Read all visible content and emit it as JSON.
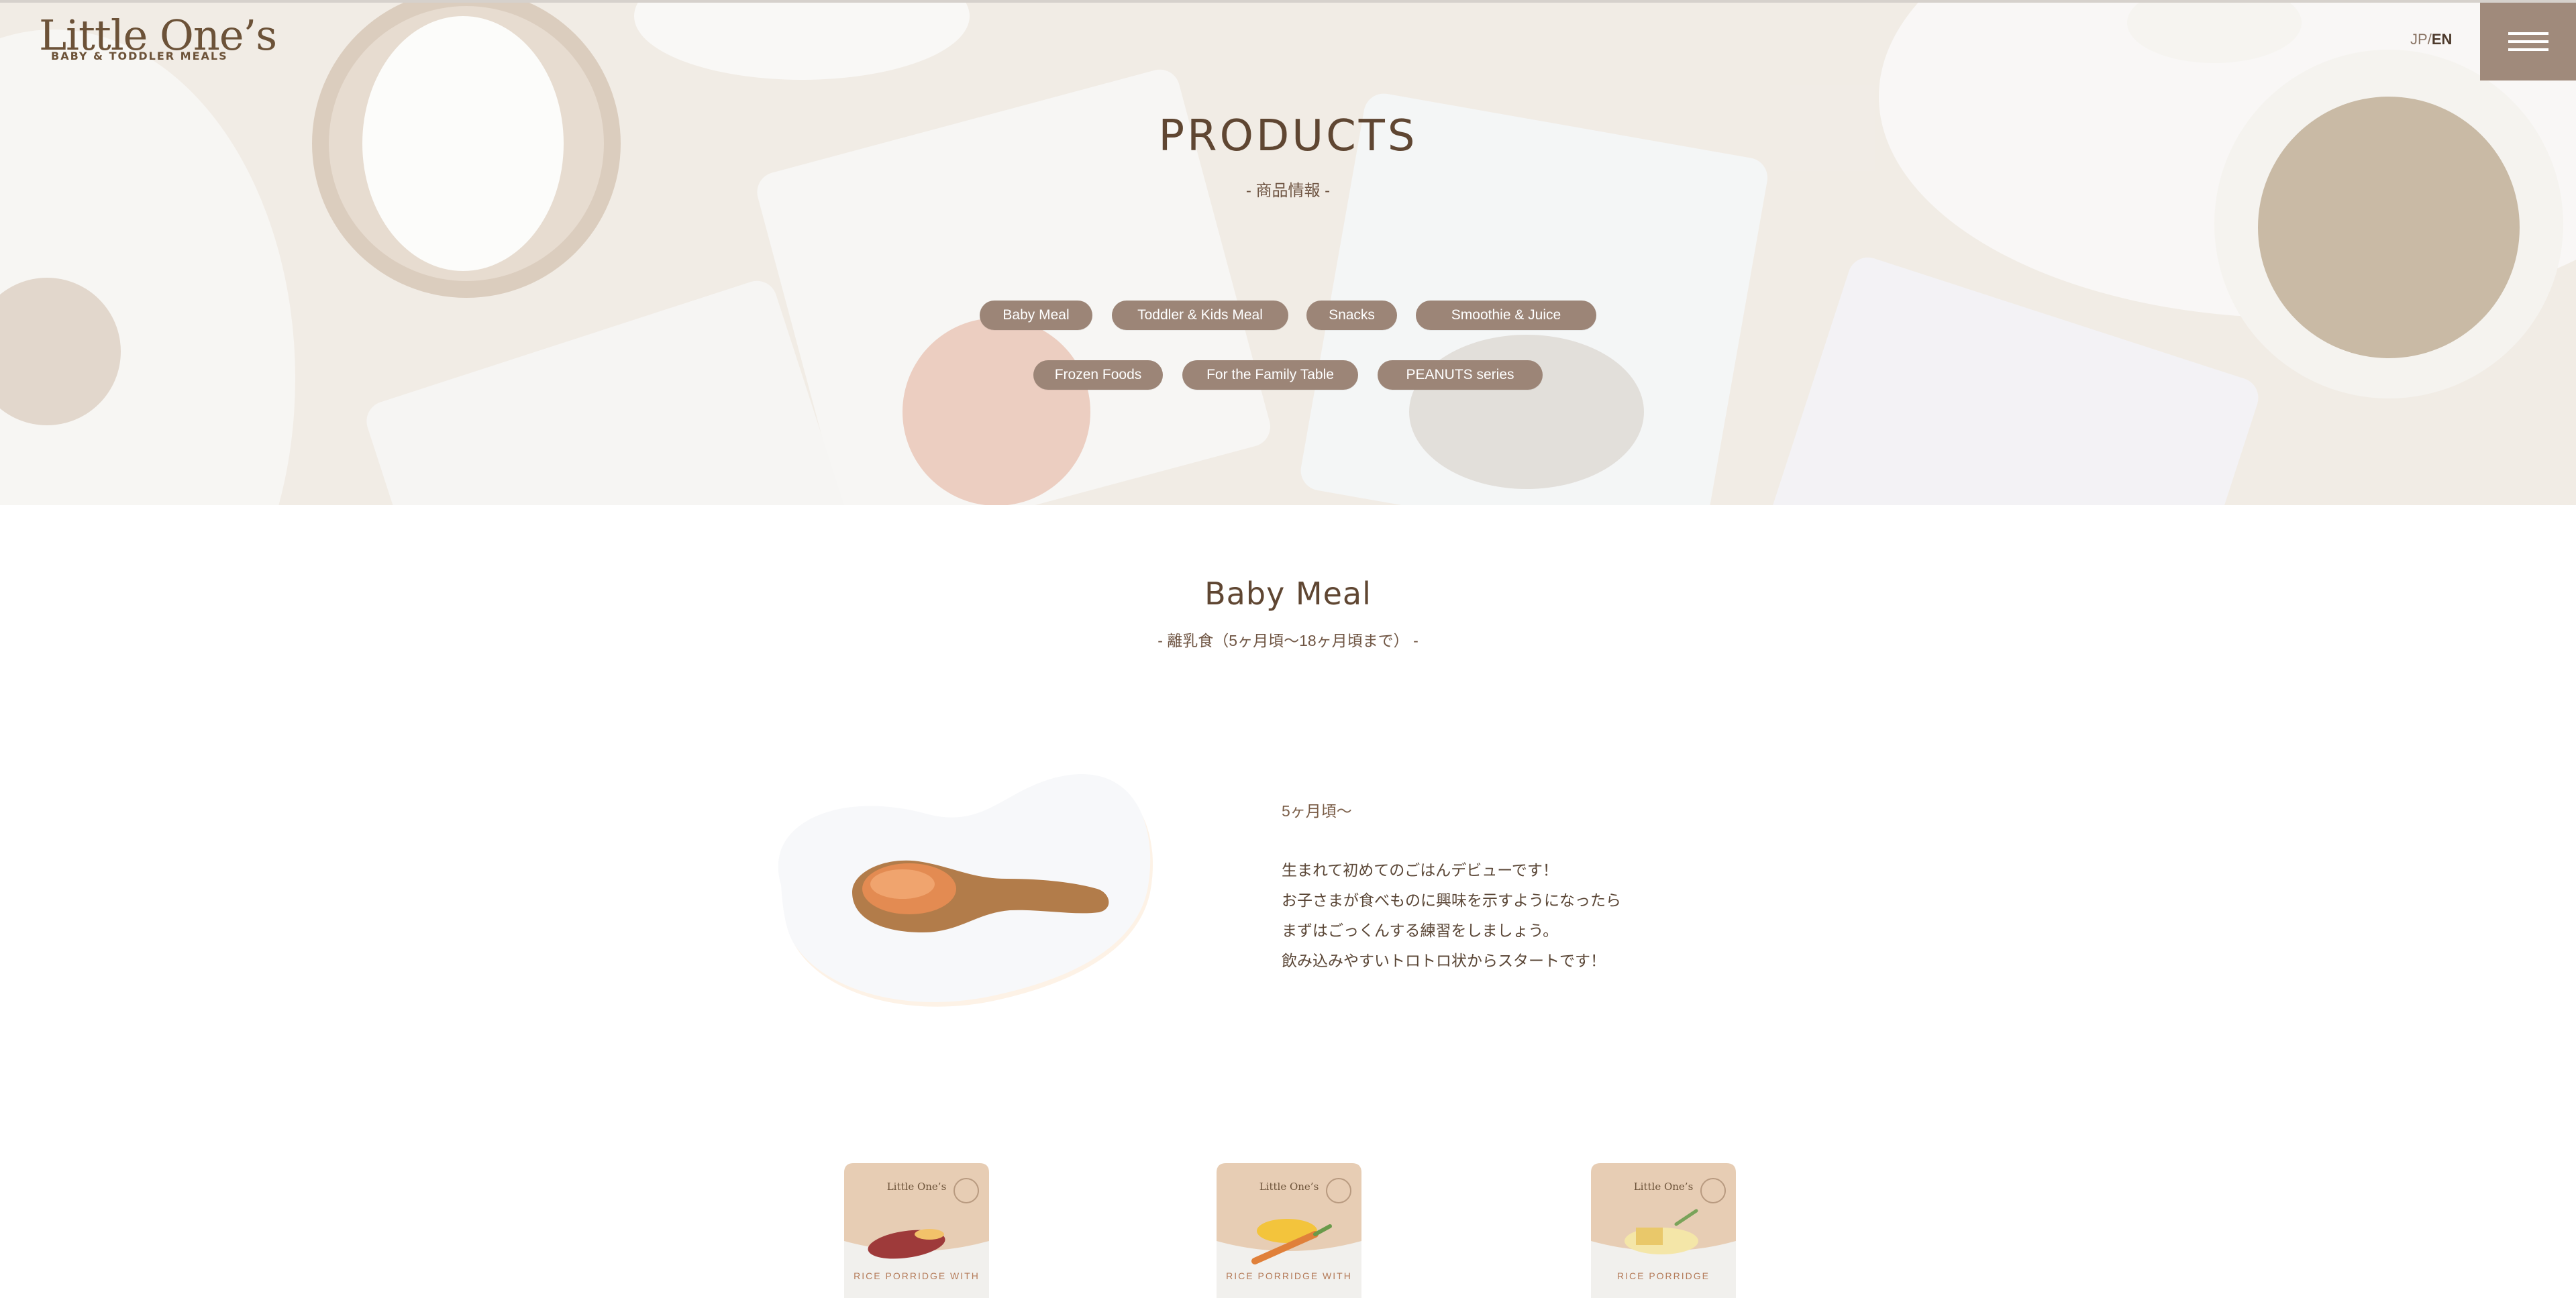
{
  "brand": {
    "name": "Little One’s",
    "tagline": "BABY & TODDLER MEALS"
  },
  "header": {
    "lang_jp": "JP",
    "lang_sep": "/",
    "lang_en": "EN",
    "menu_icon": "hamburger-icon"
  },
  "hero": {
    "title": "PRODUCTS",
    "subtitle": "- 商品情報 -",
    "categories": [
      "Baby Meal",
      "Toddler & Kids Meal",
      "Snacks",
      "Smoothie & Juice",
      "Frozen Foods",
      "For the Family Table",
      "PEANUTS series"
    ]
  },
  "section": {
    "title": "Baby Meal",
    "subtitle": "- 離乳食（5ヶ月頃〜18ヶ月頃まで） -",
    "age": "5ヶ月頃〜",
    "description": [
      "生まれて初めてのごはんデビューです！",
      "お子さまが食べものに興味を示すようになったら",
      "まずはごっくんする練習をしましょう。",
      "飲み込みやすいトロトロ状からスタートです！"
    ]
  },
  "products": [
    {
      "brand": "Little One’s",
      "name": "RICE PORRIDGE WITH"
    },
    {
      "brand": "Little One’s",
      "name": "RICE PORRIDGE WITH"
    },
    {
      "brand": "Little One’s",
      "name": "RICE PORRIDGE"
    }
  ],
  "colors": {
    "pill_bg": "#9c8577",
    "menu_bg": "#a08a7b",
    "heading": "#5f4632"
  }
}
